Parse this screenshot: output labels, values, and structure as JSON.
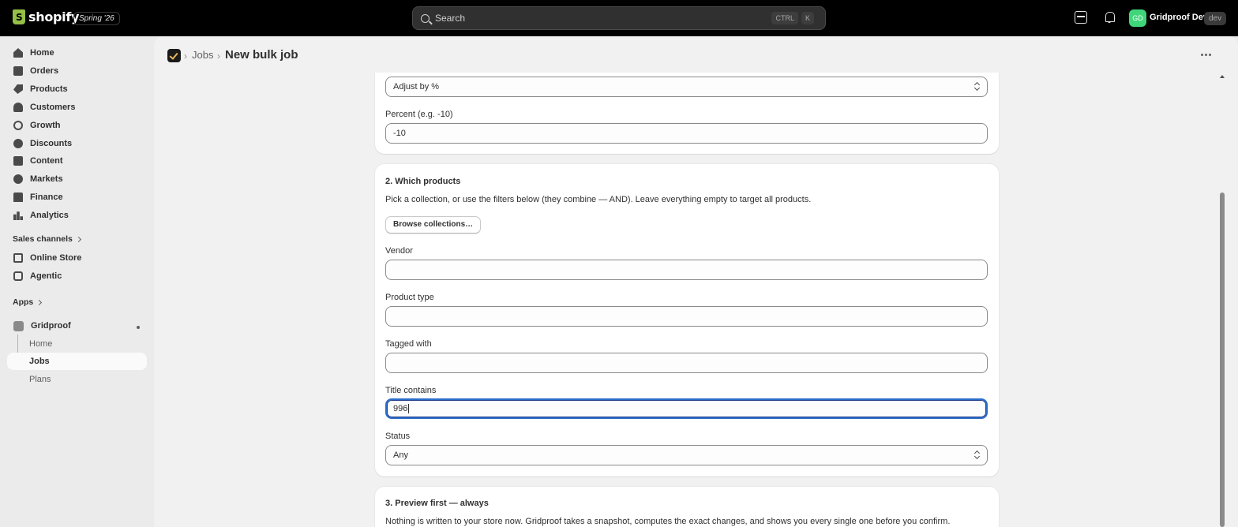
{
  "topbar": {
    "brand": "shopify",
    "edition": "Spring '26",
    "search_placeholder": "Search",
    "shortcut": [
      "CTRL",
      "K"
    ],
    "avatar_initials": "GD",
    "store_name": "Gridproof Dev",
    "env_badge": "dev"
  },
  "sidebar": {
    "items": [
      "Home",
      "Orders",
      "Products",
      "Customers",
      "Growth",
      "Discounts",
      "Content",
      "Markets",
      "Finance",
      "Analytics"
    ],
    "sales_channels_label": "Sales channels",
    "sales_channels": [
      "Online Store",
      "Agentic"
    ],
    "apps_label": "Apps",
    "app_name": "Gridproof",
    "app_subitems": [
      "Home",
      "Jobs",
      "Plans"
    ],
    "active_subitem": "Jobs"
  },
  "header": {
    "breadcrumb_link": "Jobs",
    "title": "New bulk job"
  },
  "card1": {
    "adjust_select": "Adjust by %",
    "percent_label": "Percent (e.g. -10)",
    "percent_value": "-10"
  },
  "card2": {
    "heading": "2. Which products",
    "description": "Pick a collection, or use the filters below (they combine — AND). Leave everything empty to target all products.",
    "browse_button": "Browse collections…",
    "vendor_label": "Vendor",
    "vendor_value": "",
    "product_type_label": "Product type",
    "product_type_value": "",
    "tagged_label": "Tagged with",
    "tagged_value": "",
    "title_contains_label": "Title contains",
    "title_contains_value": "996",
    "status_label": "Status",
    "status_value": "Any"
  },
  "card3": {
    "heading": "3. Preview first — always",
    "description": "Nothing is written to your store now. Gridproof takes a snapshot, computes the exact changes, and shows you every single one before you confirm."
  },
  "colors": {
    "topbar_bg": "#000000",
    "focus_ring": "#2c6ecb",
    "avatar_bg": "#3fd67a"
  }
}
